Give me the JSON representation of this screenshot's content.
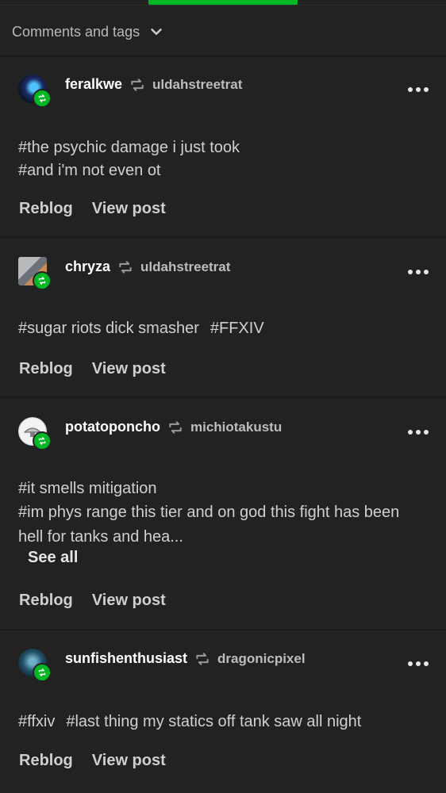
{
  "header": {
    "title": "Comments and tags"
  },
  "actions": {
    "reblog": "Reblog",
    "view_post": "View post"
  },
  "posts": [
    {
      "username": "feralkwe",
      "source": "uldahstreetrat",
      "tags": [
        "#the psychic damage i just took",
        "#and i'm not even ot"
      ],
      "avatar_color": "#1e3a5f"
    },
    {
      "username": "chryza",
      "source": "uldahstreetrat",
      "tags": [
        "#sugar riots dick smasher",
        "#FFXIV"
      ],
      "avatar_color": "#8a8f96"
    },
    {
      "username": "potatoponcho",
      "source": "michiotakustu",
      "tags": [
        "#it smells mitigation",
        "#im phys range this tier and on god this fight has been hell for tanks and hea..."
      ],
      "see_all": "See all",
      "avatar_color": "#f2f2f2"
    },
    {
      "username": "sunfishenthusiast",
      "source": "dragonicpixel",
      "tags": [
        "#ffxiv",
        "#last thing my statics off tank saw all night"
      ],
      "avatar_color": "#2a5a6e"
    }
  ],
  "colors": {
    "accent": "#00b824",
    "background": "#222222"
  }
}
